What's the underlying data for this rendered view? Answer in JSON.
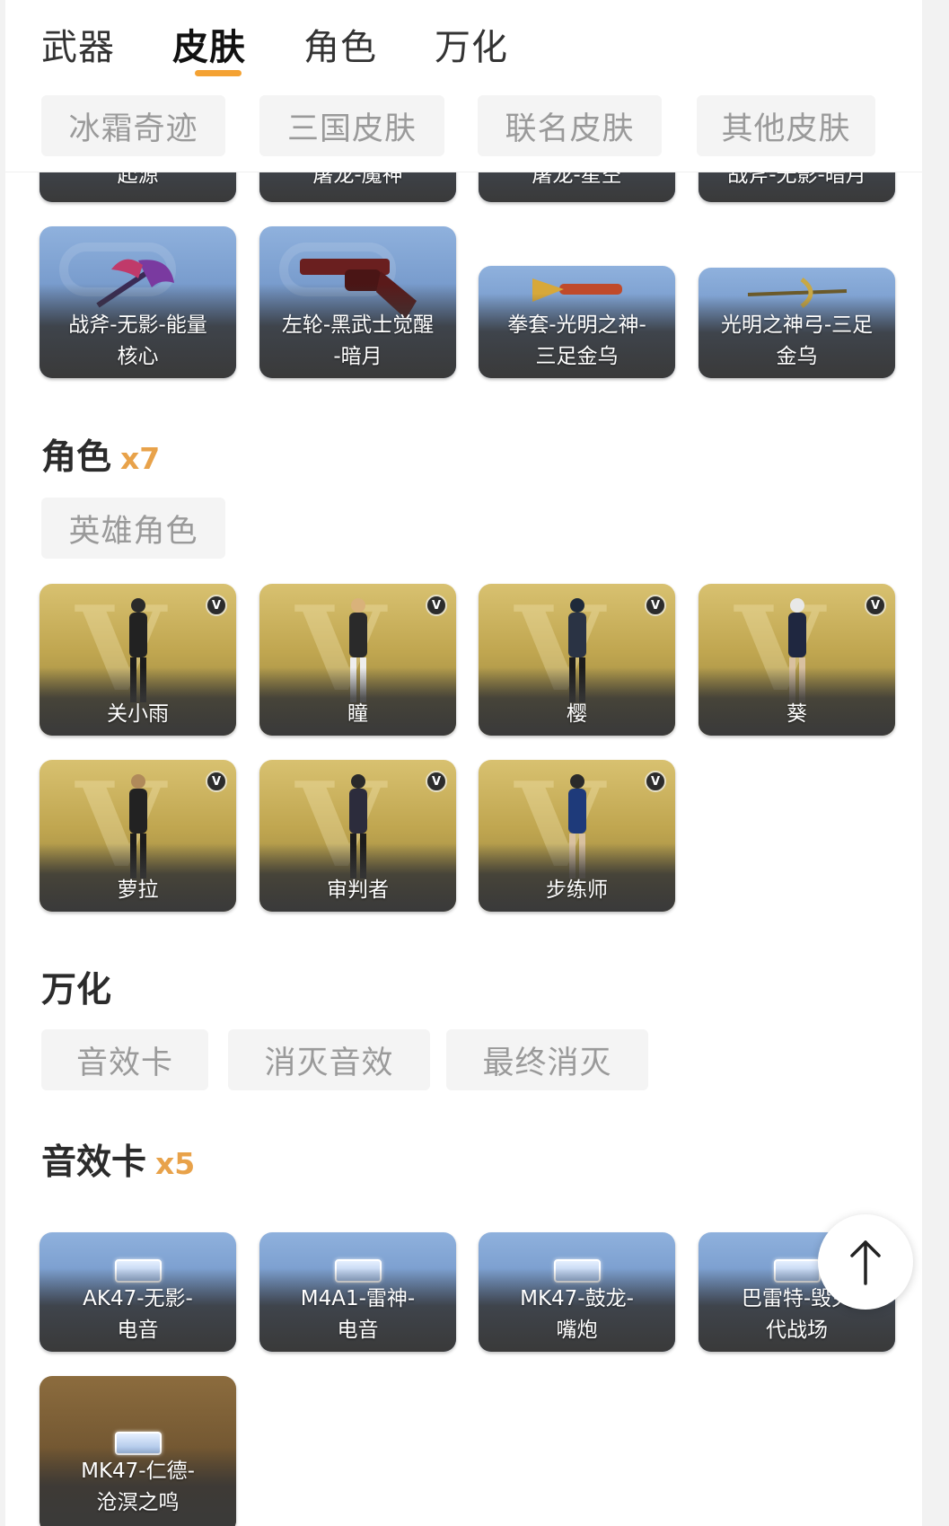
{
  "tabs": [
    {
      "label": "武器",
      "active": false
    },
    {
      "label": "皮肤",
      "active": true
    },
    {
      "label": "角色",
      "active": false
    },
    {
      "label": "万化",
      "active": false
    }
  ],
  "skin_filters": [
    "冰霜奇迹",
    "三国皮肤",
    "联名皮肤",
    "其他皮肤"
  ],
  "skin_cards_top": [
    "起源",
    "屠龙-魔神",
    "屠龙-星空",
    "战斧-无影-暗月"
  ],
  "skin_cards": [
    {
      "line1": "战斧-无影-能量",
      "line2": "核心"
    },
    {
      "line1": "左轮-黑武士觉醒",
      "line2": "-暗月"
    },
    {
      "line1": "拳套-光明之神-",
      "line2": "三足金乌"
    },
    {
      "line1": "光明之神弓-三足",
      "line2": "金乌"
    }
  ],
  "role_section": {
    "title": "角色",
    "count": "x7",
    "filter": "英雄角色"
  },
  "role_cards": [
    "关小雨",
    "瞳",
    "樱",
    "葵",
    "萝拉",
    "审判者",
    "步练师"
  ],
  "role_badge": "V",
  "wanhua_section": {
    "title": "万化",
    "filters": [
      "音效卡",
      "消灭音效",
      "最终消灭"
    ]
  },
  "sound_section": {
    "title": "音效卡",
    "count": "x5"
  },
  "sound_cards": [
    {
      "line1": "AK47-无影-",
      "line2": "电音"
    },
    {
      "line1": "M4A1-雷神-",
      "line2": "电音"
    },
    {
      "line1": "MK47-鼓龙-",
      "line2": "嘴炮"
    },
    {
      "line1": "巴雷特-毁灭",
      "line2": "代战场"
    },
    {
      "line1": "MK47-仁德-",
      "line2": "沧溟之鸣"
    }
  ],
  "icons": {
    "scroll_top": "arrow-up-icon"
  },
  "colors": {
    "accent": "#f4a233",
    "count": "#e8a24a"
  }
}
